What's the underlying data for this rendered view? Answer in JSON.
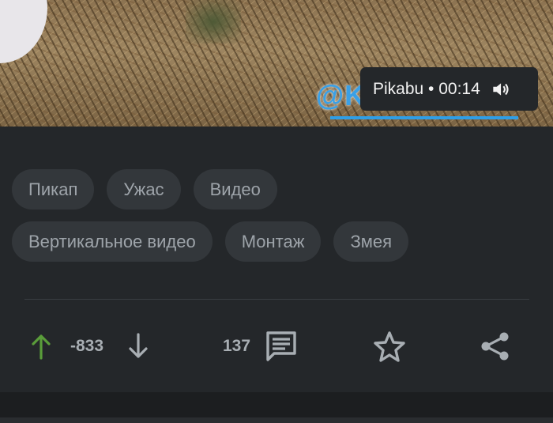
{
  "video": {
    "watermark_text": "@KLIZMaTG",
    "overlay_text": "Pikabu • 00:14",
    "volume_icon": "volume-icon"
  },
  "tags": [
    [
      "Пикап",
      "Ужас",
      "Видео"
    ],
    [
      "Вертикальное видео",
      "Монтаж",
      "Змея"
    ]
  ],
  "actions": {
    "rating": "-833",
    "comments_count": "137",
    "icons": {
      "upvote": "arrow-up-icon",
      "downvote": "arrow-down-icon",
      "comments": "comment-icon",
      "save": "star-icon",
      "share": "share-icon"
    }
  },
  "colors": {
    "upvote": "#5a9d3a",
    "icon": "#a8aeb3",
    "panel_bg": "#24272a",
    "tag_bg": "#33373b"
  }
}
